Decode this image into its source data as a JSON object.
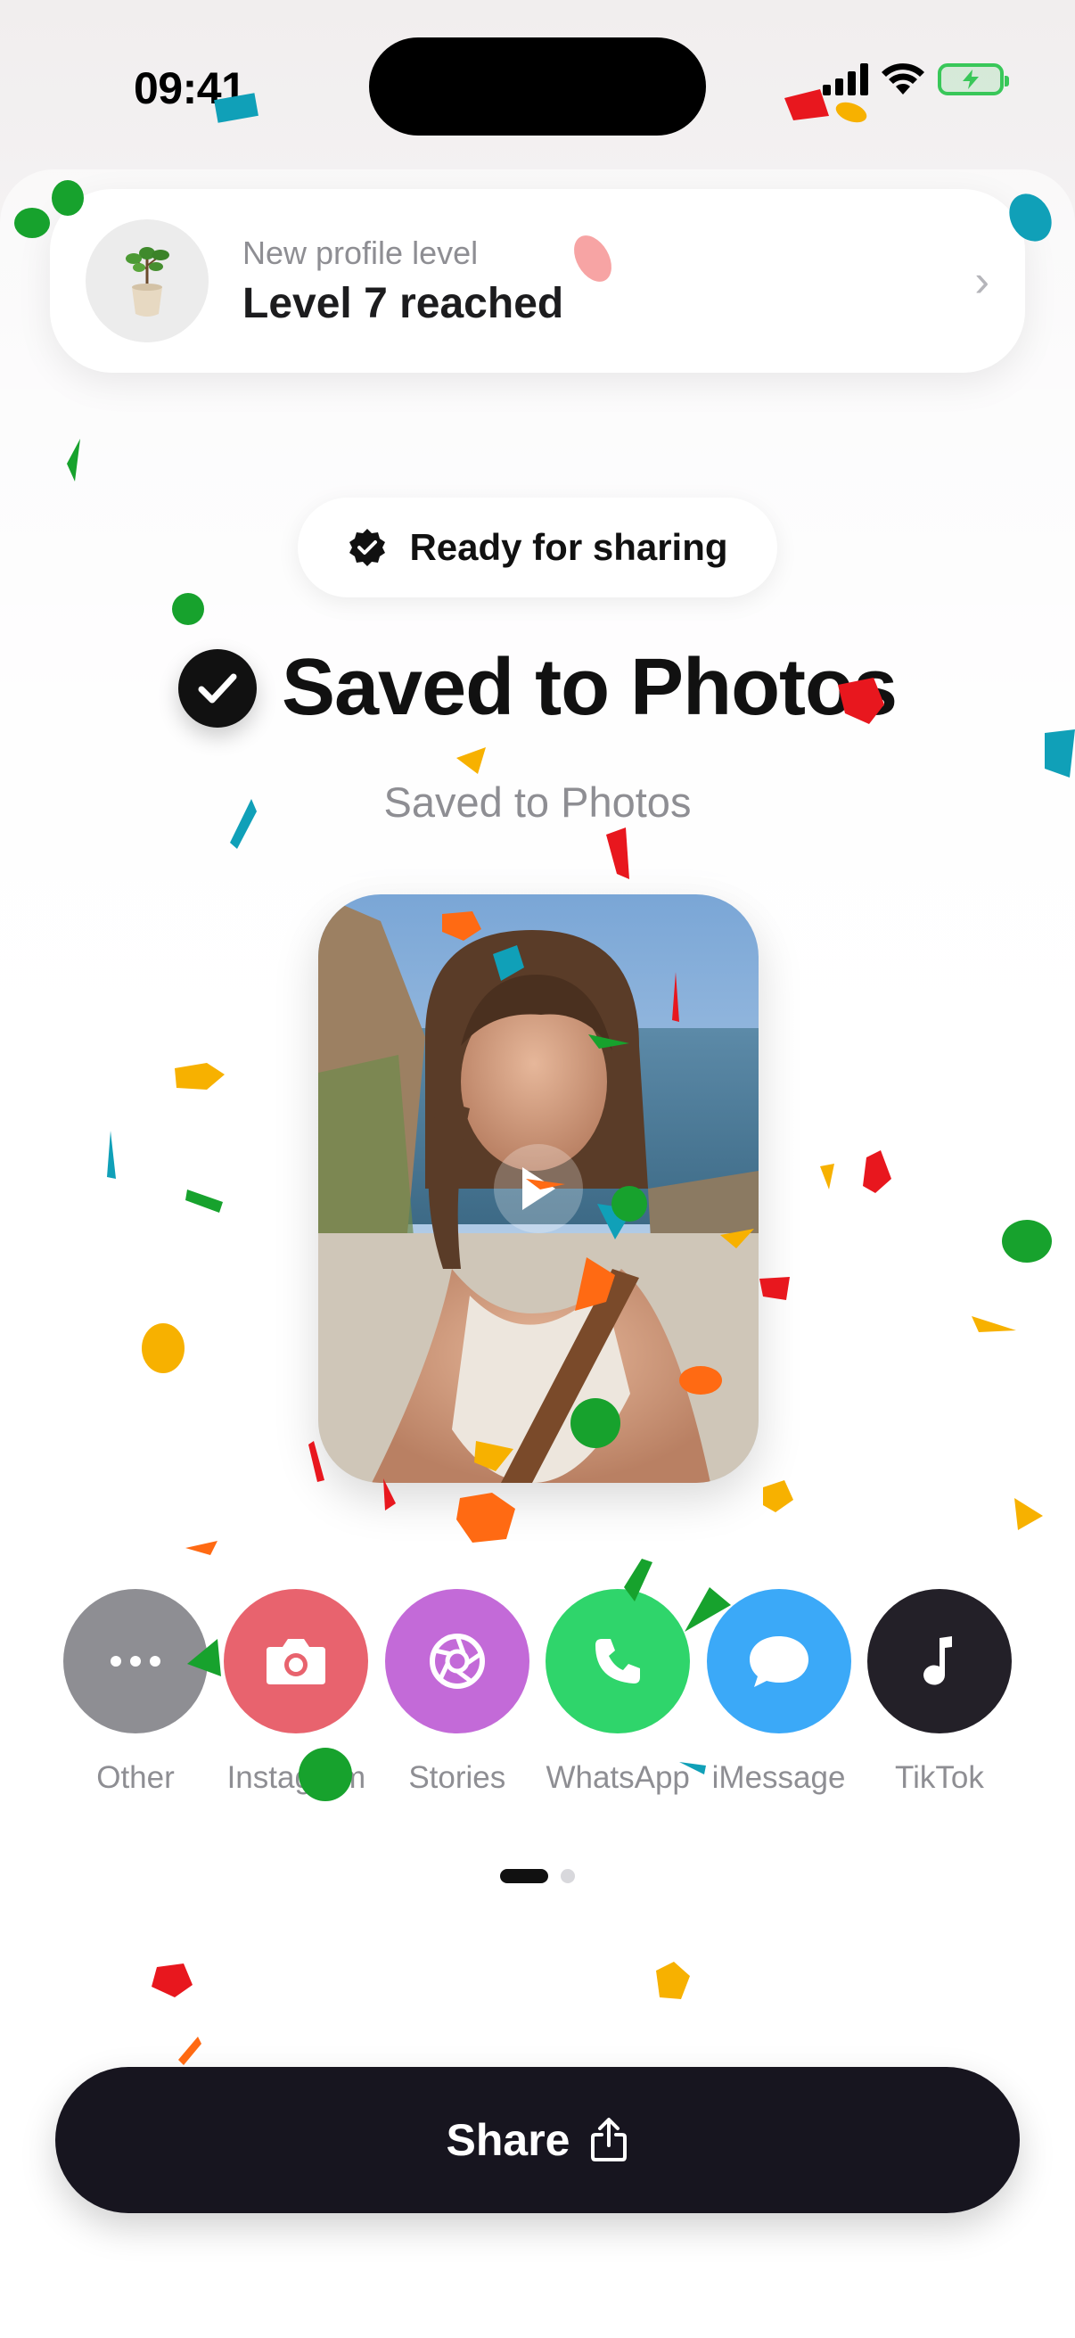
{
  "status_bar": {
    "time": "09:41"
  },
  "banner": {
    "subtitle": "New profile level",
    "title": "Level 7 reached",
    "icon": "plant-pot-icon"
  },
  "ready_pill": {
    "label": "Ready for sharing",
    "icon": "verified-badge-icon"
  },
  "saved": {
    "title": "Saved to Photos",
    "subtitle": "Saved to Photos"
  },
  "share_targets": [
    {
      "label": "Other",
      "color": "#8e8e93",
      "icon": "more-icon"
    },
    {
      "label": "Instagram",
      "color": "#e8636e",
      "icon": "camera-icon"
    },
    {
      "label": "Stories",
      "color": "#c36ad8",
      "icon": "aperture-icon"
    },
    {
      "label": "WhatsApp",
      "color": "#2fd56b",
      "icon": "phone-icon"
    },
    {
      "label": "iMessage",
      "color": "#3ba9f8",
      "icon": "message-icon"
    },
    {
      "label": "TikTok",
      "color": "#232028",
      "icon": "music-note-icon"
    }
  ],
  "share_button": {
    "label": "Share",
    "icon": "share-icon"
  },
  "pager": {
    "pages": 2,
    "active": 1
  }
}
